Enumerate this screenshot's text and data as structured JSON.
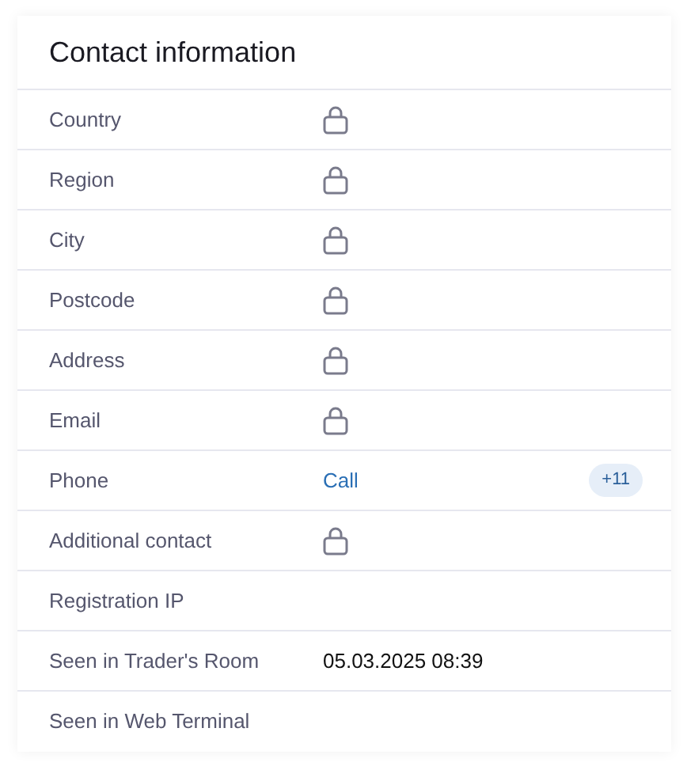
{
  "title": "Contact information",
  "rows": [
    {
      "label": "Country",
      "kind": "locked"
    },
    {
      "label": "Region",
      "kind": "locked"
    },
    {
      "label": "City",
      "kind": "locked"
    },
    {
      "label": "Postcode",
      "kind": "locked"
    },
    {
      "label": "Address",
      "kind": "locked"
    },
    {
      "label": "Email",
      "kind": "locked"
    },
    {
      "label": "Phone",
      "kind": "link",
      "value": "Call",
      "badge": "+11"
    },
    {
      "label": "Additional contact",
      "kind": "locked"
    },
    {
      "label": "Registration IP",
      "kind": "empty"
    },
    {
      "label": "Seen in Trader's Room",
      "kind": "text",
      "value": "05.03.2025 08:39"
    },
    {
      "label": "Seen in Web Terminal",
      "kind": "empty"
    }
  ]
}
